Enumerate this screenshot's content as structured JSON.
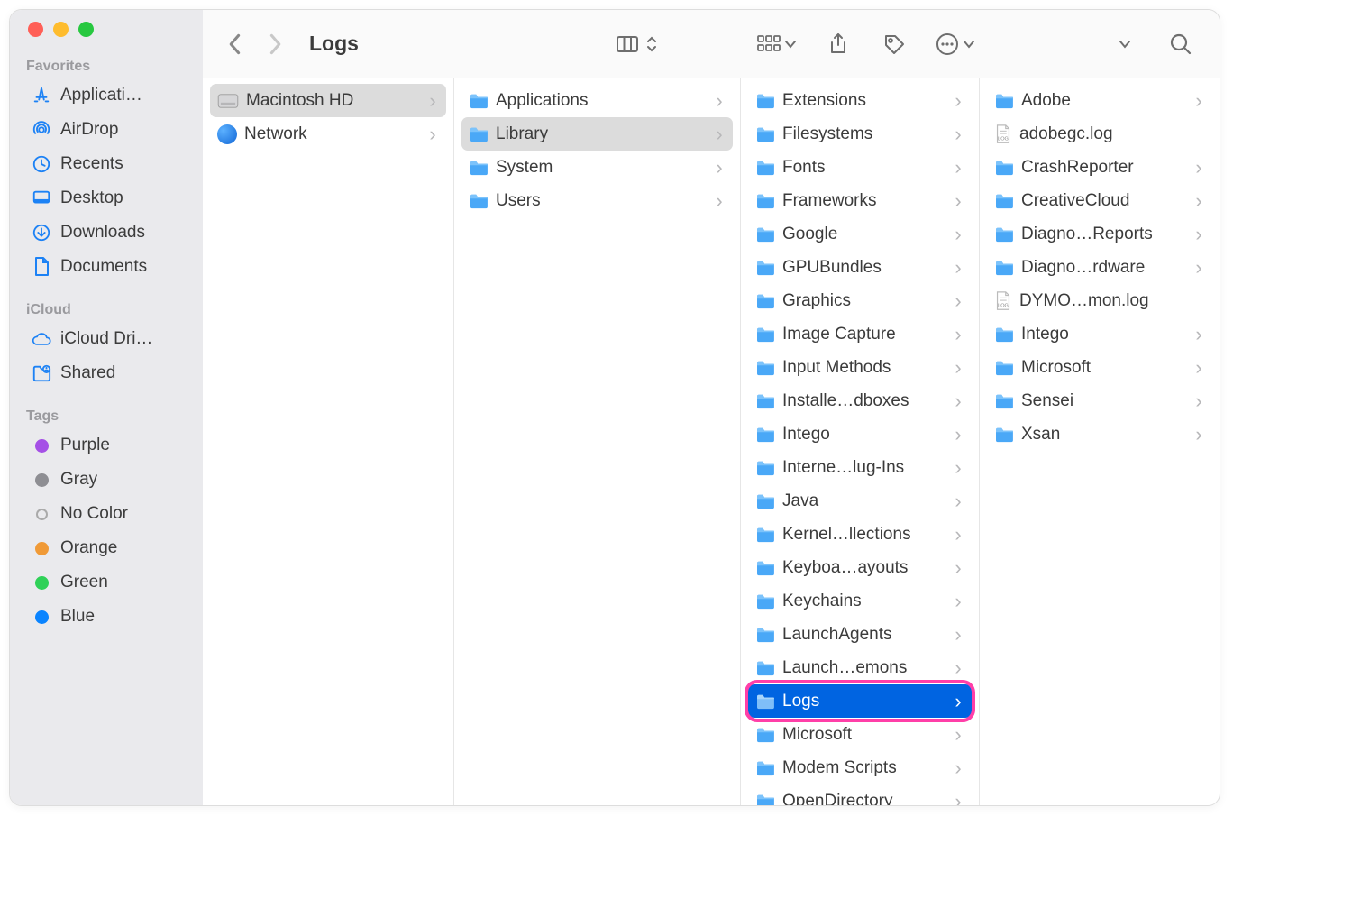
{
  "window": {
    "title": "Logs"
  },
  "sidebar": {
    "sections": [
      {
        "title": "Favorites",
        "items": [
          {
            "label": "Applicati…",
            "icon": "app-store"
          },
          {
            "label": "AirDrop",
            "icon": "airdrop"
          },
          {
            "label": "Recents",
            "icon": "recents"
          },
          {
            "label": "Desktop",
            "icon": "desktop"
          },
          {
            "label": "Downloads",
            "icon": "downloads"
          },
          {
            "label": "Documents",
            "icon": "documents"
          }
        ]
      },
      {
        "title": "iCloud",
        "items": [
          {
            "label": "iCloud Dri…",
            "icon": "cloud"
          },
          {
            "label": "Shared",
            "icon": "shared"
          }
        ]
      },
      {
        "title": "Tags",
        "items": [
          {
            "label": "Purple",
            "icon": "tag",
            "color": "#a550e6"
          },
          {
            "label": "Gray",
            "icon": "tag",
            "color": "#8e8e93"
          },
          {
            "label": "No Color",
            "icon": "tag",
            "color": "outline"
          },
          {
            "label": "Orange",
            "icon": "tag",
            "color": "#f09a37"
          },
          {
            "label": "Green",
            "icon": "tag",
            "color": "#30d158"
          },
          {
            "label": "Blue",
            "icon": "tag",
            "color": "#0a84ff"
          }
        ]
      }
    ]
  },
  "columns": [
    {
      "items": [
        {
          "label": "Macintosh HD",
          "icon": "disk",
          "selected": true,
          "hasChildren": true
        },
        {
          "label": "Network",
          "icon": "globe",
          "hasChildren": true
        }
      ]
    },
    {
      "items": [
        {
          "label": "Applications",
          "icon": "folder",
          "hasChildren": true
        },
        {
          "label": "Library",
          "icon": "folder",
          "selected": true,
          "hasChildren": true
        },
        {
          "label": "System",
          "icon": "folder",
          "hasChildren": true
        },
        {
          "label": "Users",
          "icon": "folder",
          "hasChildren": true
        }
      ]
    },
    {
      "items": [
        {
          "label": "Extensions",
          "icon": "folder",
          "hasChildren": true
        },
        {
          "label": "Filesystems",
          "icon": "folder",
          "hasChildren": true
        },
        {
          "label": "Fonts",
          "icon": "folder",
          "hasChildren": true
        },
        {
          "label": "Frameworks",
          "icon": "folder",
          "hasChildren": true
        },
        {
          "label": "Google",
          "icon": "folder",
          "hasChildren": true
        },
        {
          "label": "GPUBundles",
          "icon": "folder",
          "hasChildren": true
        },
        {
          "label": "Graphics",
          "icon": "folder",
          "hasChildren": true
        },
        {
          "label": "Image Capture",
          "icon": "folder",
          "hasChildren": true
        },
        {
          "label": "Input Methods",
          "icon": "folder",
          "hasChildren": true
        },
        {
          "label": "Installe…dboxes",
          "icon": "folder",
          "hasChildren": true
        },
        {
          "label": "Intego",
          "icon": "folder",
          "hasChildren": true
        },
        {
          "label": "Interne…lug-Ins",
          "icon": "folder",
          "hasChildren": true
        },
        {
          "label": "Java",
          "icon": "folder",
          "hasChildren": true
        },
        {
          "label": "Kernel…llections",
          "icon": "folder",
          "hasChildren": true
        },
        {
          "label": "Keyboa…ayouts",
          "icon": "folder",
          "hasChildren": true
        },
        {
          "label": "Keychains",
          "icon": "folder",
          "hasChildren": true
        },
        {
          "label": "LaunchAgents",
          "icon": "folder",
          "hasChildren": true
        },
        {
          "label": "Launch…emons",
          "icon": "folder",
          "hasChildren": true
        },
        {
          "label": "Logs",
          "icon": "folder",
          "highlighted": true,
          "hasChildren": true,
          "ring": true
        },
        {
          "label": "Microsoft",
          "icon": "folder",
          "hasChildren": true
        },
        {
          "label": "Modem Scripts",
          "icon": "folder",
          "hasChildren": true
        },
        {
          "label": "OpenDirectory",
          "icon": "folder",
          "hasChildren": true
        }
      ]
    },
    {
      "items": [
        {
          "label": "Adobe",
          "icon": "folder",
          "hasChildren": true
        },
        {
          "label": "adobegc.log",
          "icon": "logfile"
        },
        {
          "label": "CrashReporter",
          "icon": "folder",
          "hasChildren": true
        },
        {
          "label": "CreativeCloud",
          "icon": "folder",
          "hasChildren": true
        },
        {
          "label": "Diagno…Reports",
          "icon": "folder",
          "hasChildren": true
        },
        {
          "label": "Diagno…rdware",
          "icon": "folder",
          "hasChildren": true
        },
        {
          "label": "DYMO…mon.log",
          "icon": "logfile"
        },
        {
          "label": "Intego",
          "icon": "folder",
          "hasChildren": true
        },
        {
          "label": "Microsoft",
          "icon": "folder",
          "hasChildren": true
        },
        {
          "label": "Sensei",
          "icon": "folder",
          "hasChildren": true
        },
        {
          "label": "Xsan",
          "icon": "folder",
          "hasChildren": true
        }
      ]
    }
  ]
}
